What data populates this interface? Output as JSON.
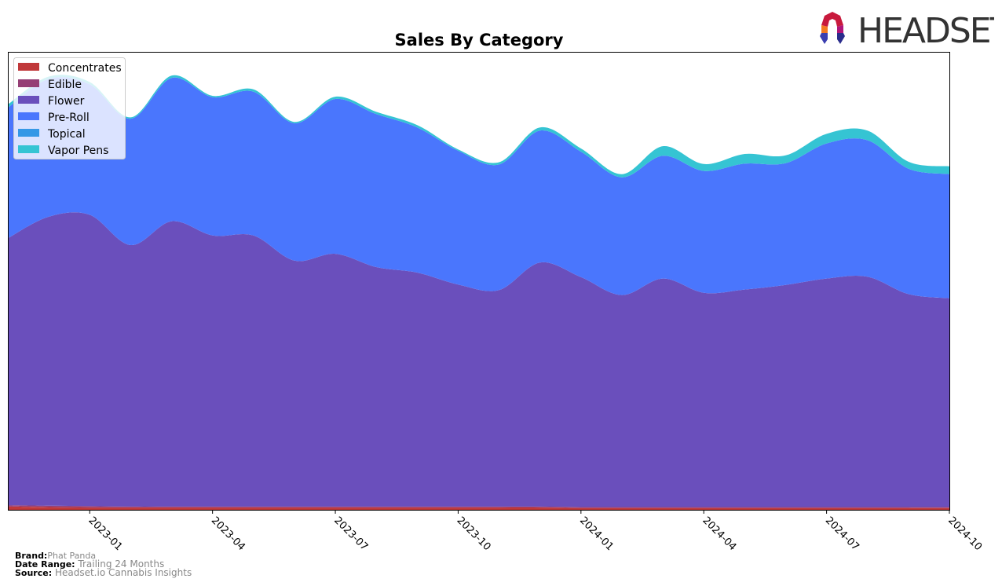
{
  "header": {
    "logo_text": "HEADSET"
  },
  "footer": {
    "brand_label": "Brand:",
    "brand_value": "Phat Panda",
    "date_range_label": "Date Range:",
    "date_range_value": "Trailing 24 Months",
    "source_label": "Source:",
    "source_value": "Headset.io Cannabis Insights"
  },
  "chart_data": {
    "type": "area",
    "stacked": true,
    "title": "Sales By Category",
    "xlabel": "",
    "ylabel": "",
    "y_units": "relative (no y-axis labels shown; values estimated as % of plot height)",
    "ylim": [
      0,
      100
    ],
    "grid": false,
    "legend_position": "top-left",
    "x": [
      "2022-11",
      "2022-12",
      "2023-01",
      "2023-02",
      "2023-03",
      "2023-04",
      "2023-05",
      "2023-06",
      "2023-07",
      "2023-08",
      "2023-09",
      "2023-10",
      "2023-11",
      "2023-12",
      "2024-01",
      "2024-02",
      "2024-03",
      "2024-04",
      "2024-05",
      "2024-06",
      "2024-07",
      "2024-08",
      "2024-09",
      "2024-10"
    ],
    "x_ticks": [
      "2023-01",
      "2023-04",
      "2023-07",
      "2023-10",
      "2024-01",
      "2024-04",
      "2024-07",
      "2024-10"
    ],
    "series": [
      {
        "name": "Concentrates",
        "color": "#c0383a",
        "values": [
          0.7,
          0.6,
          0.5,
          0.5,
          0.5,
          0.5,
          0.5,
          0.5,
          0.5,
          0.5,
          0.5,
          0.5,
          0.5,
          0.5,
          0.4,
          0.4,
          0.4,
          0.4,
          0.4,
          0.4,
          0.4,
          0.4,
          0.4,
          0.4
        ]
      },
      {
        "name": "Edible",
        "color": "#953f75",
        "values": [
          0.3,
          0.3,
          0.3,
          0.2,
          0.2,
          0.2,
          0.2,
          0.2,
          0.2,
          0.2,
          0.2,
          0.2,
          0.2,
          0.2,
          0.2,
          0.2,
          0.2,
          0.2,
          0.2,
          0.2,
          0.2,
          0.2,
          0.2,
          0.2
        ]
      },
      {
        "name": "Flower",
        "color": "#6a4fbc",
        "values": [
          58.3,
          63.1,
          63.6,
          57.1,
          62.3,
          59.2,
          59.2,
          53.7,
          55.2,
          52.3,
          51.1,
          48.5,
          47.3,
          53.3,
          50.2,
          46.3,
          49.9,
          46.8,
          47.5,
          48.5,
          49.9,
          50.3,
          46.5,
          45.6
        ]
      },
      {
        "name": "Pre-Roll",
        "color": "#4a76fd",
        "values": [
          28.5,
          30.1,
          28.5,
          27.6,
          31.3,
          30.2,
          31.4,
          30.0,
          33.8,
          33.4,
          31.7,
          29.2,
          27.4,
          28.8,
          27.4,
          25.7,
          26.8,
          26.6,
          27.5,
          26.6,
          29.5,
          29.8,
          27.4,
          27.1
        ]
      },
      {
        "name": "Topical",
        "color": "#3598e6",
        "values": [
          0,
          0,
          0,
          0,
          0,
          0,
          0,
          0,
          0,
          0,
          0,
          0,
          0,
          0,
          0,
          0,
          0,
          0,
          0,
          0,
          0,
          0,
          0,
          0
        ]
      },
      {
        "name": "Vapor Pens",
        "color": "#35c4d3",
        "values": [
          0.7,
          0.5,
          0.5,
          0.3,
          0.5,
          0.3,
          0.5,
          0.3,
          0.5,
          0.5,
          0.5,
          0.3,
          0.5,
          0.7,
          0.7,
          0.7,
          2.1,
          1.5,
          2.1,
          1.7,
          2.1,
          2.1,
          1.5,
          1.7
        ]
      }
    ]
  }
}
